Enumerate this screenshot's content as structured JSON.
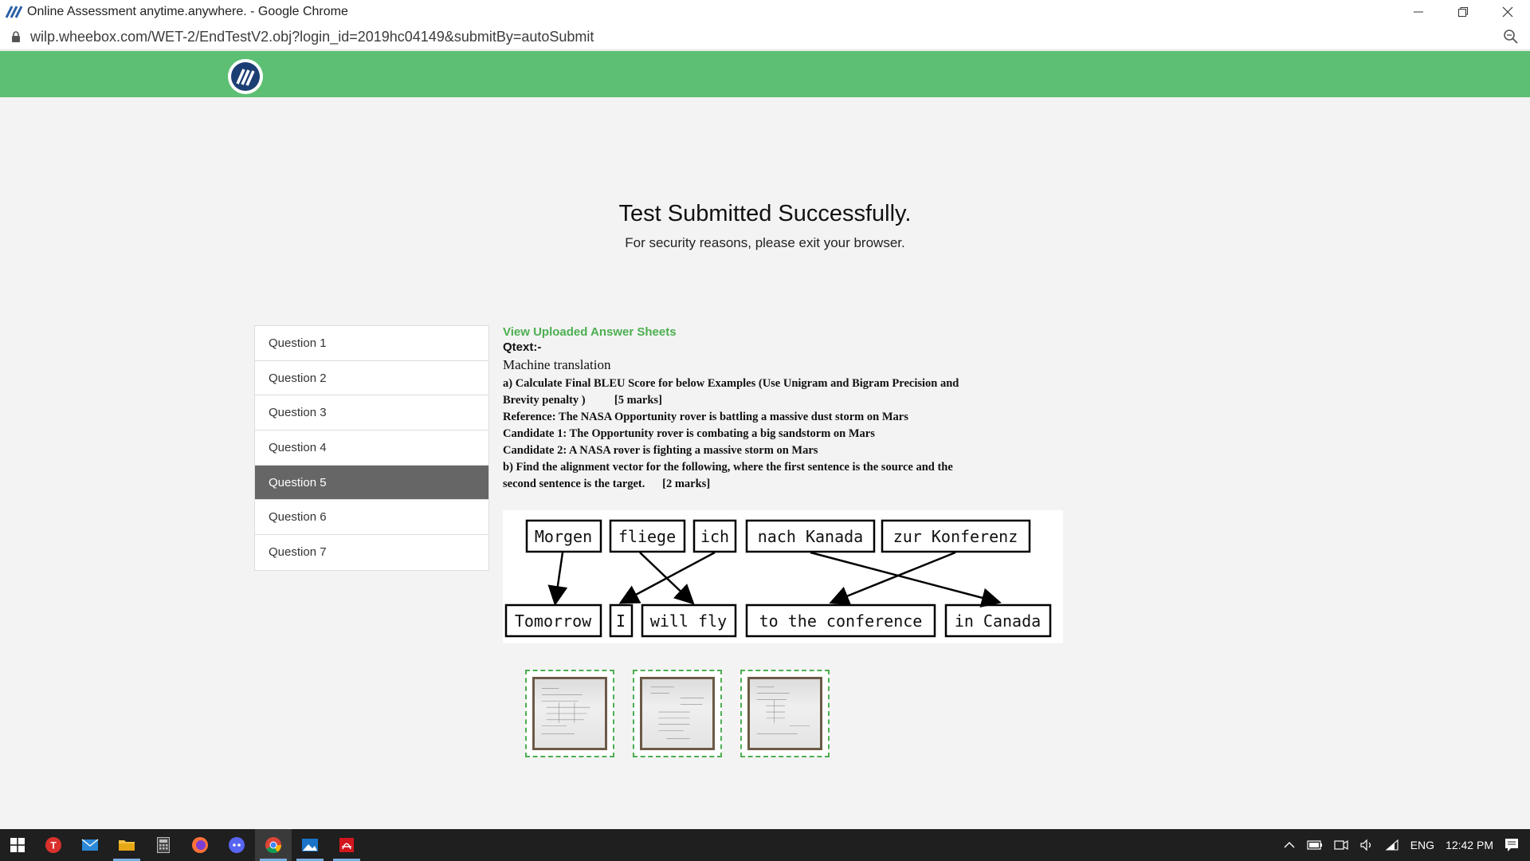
{
  "window": {
    "title": "Online Assessment anytime.anywhere. - Google Chrome",
    "url": "wilp.wheebox.com/WET-2/EndTestV2.obj?login_id=2019hc04149&submitBy=autoSubmit"
  },
  "status": {
    "title": "Test Submitted Successfully.",
    "subtitle": "For security reasons, please exit your browser."
  },
  "questions": [
    "Question 1",
    "Question 2",
    "Question 3",
    "Question 4",
    "Question 5",
    "Question 6",
    "Question 7"
  ],
  "active_question_index": 4,
  "answer": {
    "view_link": "View Uploaded Answer Sheets",
    "qtext_label": "Qtext:-",
    "heading": "Machine translation",
    "lines": [
      "a) Calculate Final BLEU Score for below Examples (Use Unigram and Bigram Precision and",
      "Brevity penalty )          [5 marks]",
      "Reference: The NASA Opportunity rover is battling a massive dust storm on Mars",
      "Candidate 1: The Opportunity rover is combating a big sandstorm on Mars",
      "Candidate 2: A NASA rover is fighting a massive storm on Mars",
      "b) Find the alignment vector for the following, where the first sentence is the source and the",
      "second sentence is the target.      [2 marks]"
    ]
  },
  "diagram": {
    "source": [
      "Morgen",
      "fliege",
      "ich",
      "nach Kanada",
      "zur Konferenz"
    ],
    "target": [
      "Tomorrow",
      "I",
      "will fly",
      "to the conference",
      "in Canada"
    ]
  },
  "answer_sheets": [
    "sheet-1",
    "sheet-2",
    "sheet-3"
  ],
  "taskbar": {
    "language": "ENG",
    "time": "12:42 PM"
  },
  "colors": {
    "header_green": "#5cbf73",
    "link_green": "#4caf50",
    "active_question": "#666666"
  }
}
